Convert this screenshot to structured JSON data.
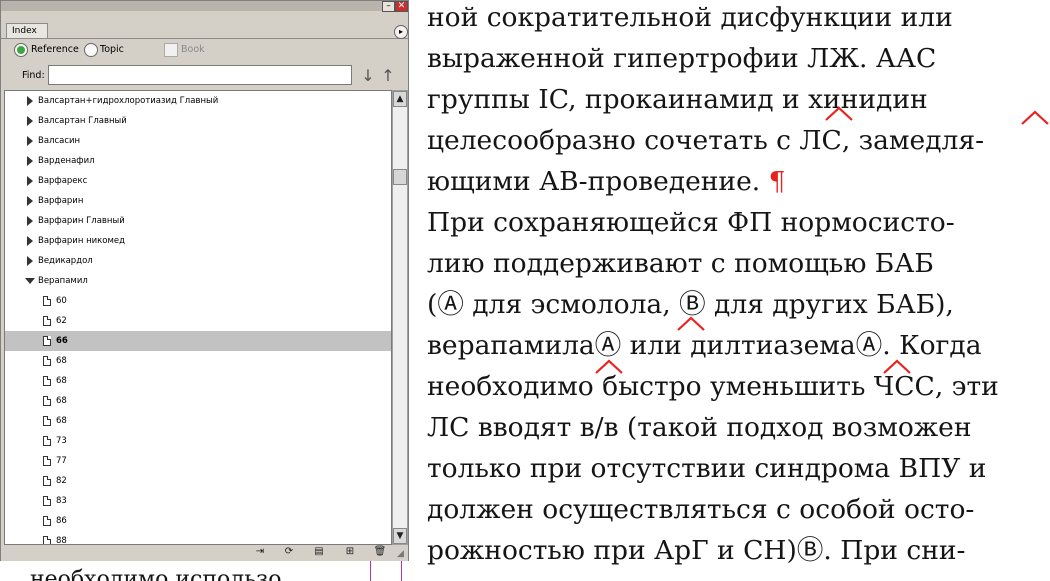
{
  "panel": {
    "tab_label": "Index",
    "radio_reference": "Reference",
    "radio_topic": "Topic",
    "checkbox_book": "Book",
    "find_label": "Find:",
    "find_value": "",
    "minimize_glyph": "–",
    "close_glyph": "✕",
    "menu_glyph": "▸",
    "up_arrow": "↑",
    "down_arrow": "↓",
    "scroll_up": "▲",
    "scroll_down": "▼",
    "entries": [
      {
        "label": "Валсартан+гидрохлоротиазид Главный"
      },
      {
        "label": "Валсартан Главный"
      },
      {
        "label": "Валсасин"
      },
      {
        "label": "Варденафил"
      },
      {
        "label": "Варфарекс"
      },
      {
        "label": "Варфарин"
      },
      {
        "label": "Варфарин Главный"
      },
      {
        "label": "Варфарин никомед"
      },
      {
        "label": "Ведикардол"
      },
      {
        "label": "Верапамил"
      }
    ],
    "pages": [
      "60",
      "62",
      "66",
      "68",
      "68",
      "68",
      "68",
      "73",
      "77",
      "82",
      "83",
      "86",
      "88"
    ],
    "selected_page_index": 2,
    "toolbar_icons": [
      "go-to-entry-icon",
      "update-preview-icon",
      "generate-index-icon",
      "new-entry-icon",
      "delete-entry-icon"
    ]
  },
  "document": {
    "lines": [
      "ной сократительной дисфункции или",
      "выраженной гипертрофии ЛЖ. ААС",
      "группы IC, прокаинамид и хинидин",
      "целесообразно сочетать с ЛС, замедля-",
      "ющими АВ-проведение.",
      "При сохраняющейся ФП нормосисто-",
      "лию поддерживают с помощью БАБ",
      "(Ⓐ для эсмолола, Ⓑ для других БАБ),",
      "верапамилаⒶ или дилтиаземаⒶ. Когда",
      "необходимо быстро уменьшить ЧСС, эти",
      "ЛС вводят в/в (такой подход возможен",
      "только при отсутствии синдрома ВПУ и",
      "должен осуществляться с особой осто-",
      "рожностью при АрГ и СН)Ⓑ. При сни-"
    ],
    "pilcrow": "¶",
    "bottom_peek": "необходимо использо"
  }
}
